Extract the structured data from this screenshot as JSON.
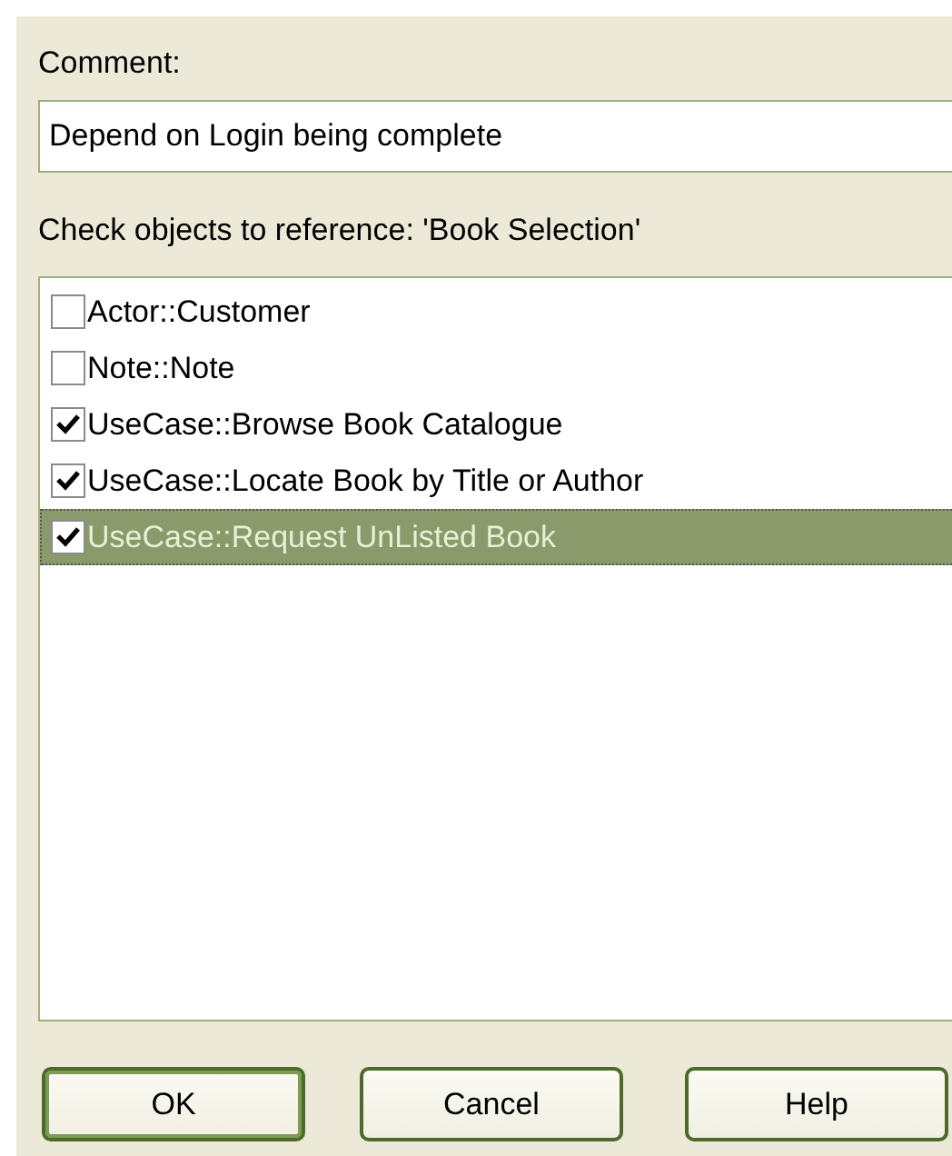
{
  "comment": {
    "label": "Comment:",
    "value": "Depend on Login being complete"
  },
  "objects": {
    "label": "Check objects to reference: 'Book Selection'",
    "items": [
      {
        "text": "Actor::Customer",
        "checked": false,
        "selected": false
      },
      {
        "text": "Note::Note",
        "checked": false,
        "selected": false
      },
      {
        "text": "UseCase::Browse Book Catalogue",
        "checked": true,
        "selected": false
      },
      {
        "text": "UseCase::Locate Book by Title or Author",
        "checked": true,
        "selected": false
      },
      {
        "text": "UseCase::Request UnListed Book",
        "checked": true,
        "selected": true
      }
    ]
  },
  "buttons": [
    {
      "label": "OK",
      "default": true
    },
    {
      "label": "Cancel",
      "default": false
    },
    {
      "label": "Help",
      "default": false
    }
  ]
}
